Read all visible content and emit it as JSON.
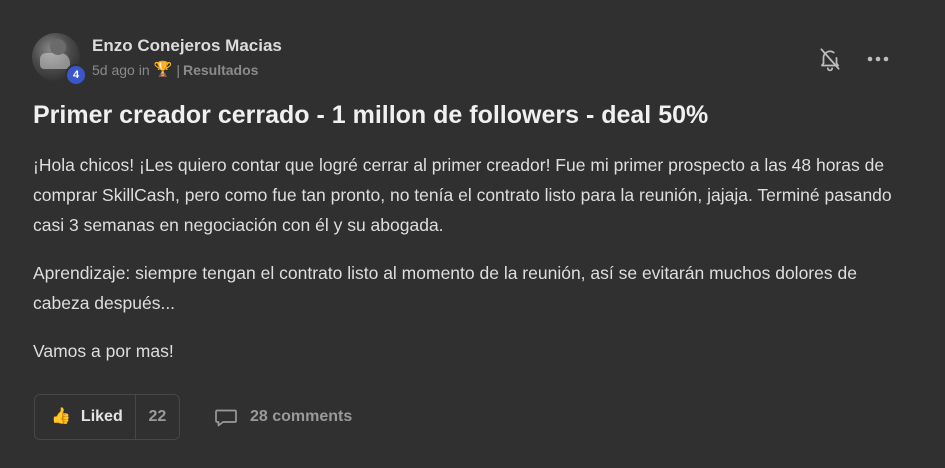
{
  "post": {
    "author": "Enzo Conejeros Macias",
    "level": "4",
    "time_ago": "5d ago",
    "in_label": "in",
    "trophy_icon": "🏆",
    "separator": "|",
    "category": "Resultados",
    "title": "Primer creador cerrado - 1 millon de followers - deal 50%",
    "paragraphs": [
      "¡Hola chicos! ¡Les quiero contar que logré cerrar al primer creador! Fue mi primer prospecto a las 48 horas de comprar SkillCash, pero como fue tan pronto, no tenía el contrato listo para la reunión, jajaja. Terminé pasando casi 3 semanas en negociación con él y su abogada.",
      "Aprendizaje: siempre tengan el contrato listo al momento de la reunión, así se evitarán muchos dolores de cabeza después...",
      "Vamos a por mas!"
    ]
  },
  "actions": {
    "like_label": "Liked",
    "like_count": "22",
    "comments_label": "28 comments",
    "thumb_icon": "👍"
  },
  "icons": {
    "bell": "bell-off-icon",
    "more": "more-horizontal-icon",
    "comment": "comment-icon"
  },
  "colors": {
    "background": "#303030",
    "level_badge": "#3a57c9",
    "accent": "#e0a21d",
    "muted_text": "#8b8b8b"
  }
}
